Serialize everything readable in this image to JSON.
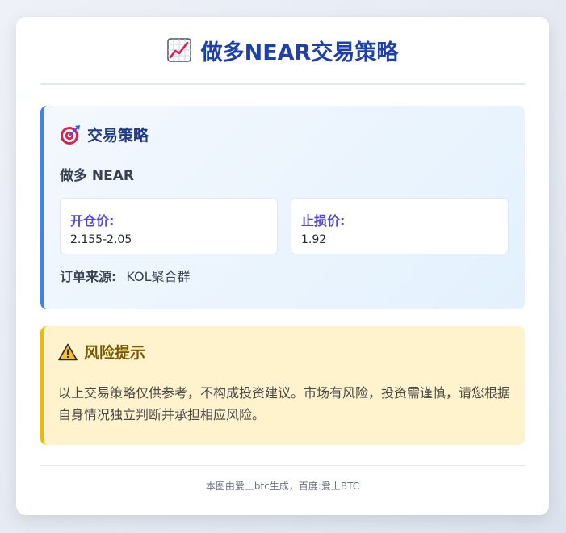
{
  "header": {
    "icon": "chart-increasing-icon",
    "title": "做多NEAR交易策略"
  },
  "strategy": {
    "icon": "target-icon",
    "title": "交易策略",
    "direction": "做多 NEAR",
    "entry": {
      "label": "开仓价:",
      "value": "2.155-2.05"
    },
    "stop_loss": {
      "label": "止损价:",
      "value": "1.92"
    },
    "source": {
      "label": "订单来源:",
      "value": "KOL聚合群"
    },
    "accent_color": "#3b82f6"
  },
  "risk": {
    "icon": "warning-icon",
    "title": "风险提示",
    "text": "以上交易策略仅供参考，不构成投资建议。市场有风险，投资需谨慎，请您根据自身情况独立判断并承担相应风险。",
    "accent_color": "#f5b800"
  },
  "footer": {
    "text": "本图由爱上btc生成，百度:爱上BTC"
  },
  "colors": {
    "title": "#1e40af",
    "price_label": "#4f46e5"
  }
}
